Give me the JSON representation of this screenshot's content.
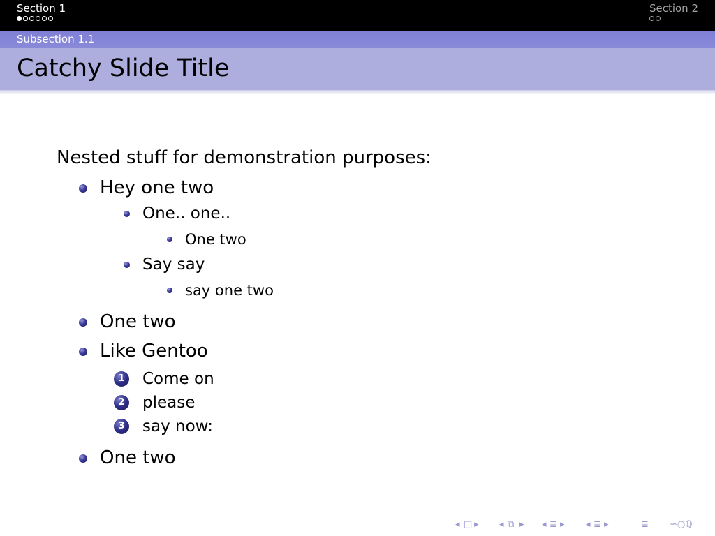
{
  "header": {
    "left_section": "Section 1",
    "left_dots": [
      true,
      false,
      false,
      false,
      false,
      false
    ],
    "right_section": "Section 2",
    "right_dots": [
      false,
      false
    ]
  },
  "subsection": "Subsection 1.1",
  "title": "Catchy Slide Title",
  "intro": "Nested stuff for demonstration purposes:",
  "items": [
    {
      "text": "Hey one two"
    },
    {
      "text": "One.. one.."
    },
    {
      "text": "One two"
    },
    {
      "text": "Say say"
    },
    {
      "text": "say one two"
    },
    {
      "text": "One two"
    },
    {
      "text": "Like Gentoo"
    },
    {
      "text": "Come on",
      "number": "1"
    },
    {
      "text": "please",
      "number": "2"
    },
    {
      "text": "say now:",
      "number": "3"
    },
    {
      "text": "One two"
    }
  ],
  "colors": {
    "nav_bar": "#000000",
    "subsection_bar": "#8585d8",
    "title_bar": "#adadde",
    "bullet": "#2e2e8a",
    "nav_symbols": "#9a9ad0"
  },
  "nav_icons": [
    "arrow-left-icon",
    "frame-icon",
    "arrow-right-icon",
    "arrow-left-icon",
    "subsection-icon",
    "arrow-right-icon",
    "arrow-left-icon",
    "section-icon",
    "arrow-right-icon",
    "arrow-left-icon",
    "list-icon",
    "arrow-right-icon",
    "align-icon",
    "search-icon"
  ]
}
